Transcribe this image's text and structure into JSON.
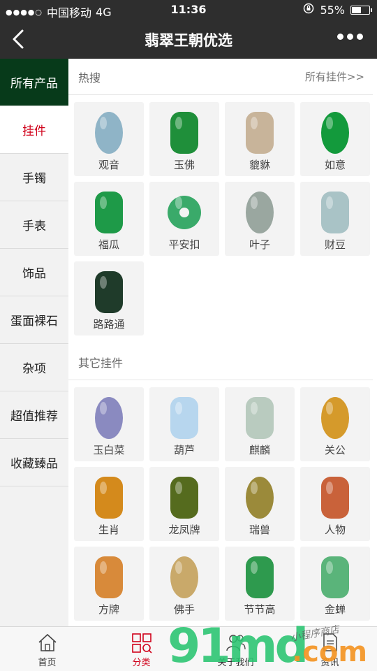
{
  "status": {
    "carrier": "中国移动",
    "network": "4G",
    "time": "11:36",
    "battery": "55%",
    "battery_level": 0.55
  },
  "nav": {
    "title": "翡翠王朝优选"
  },
  "sidebar": {
    "items": [
      {
        "label": "所有产品"
      },
      {
        "label": "挂件"
      },
      {
        "label": "手镯"
      },
      {
        "label": "手表"
      },
      {
        "label": "饰品"
      },
      {
        "label": "蛋面裸石"
      },
      {
        "label": "杂项"
      },
      {
        "label": "超值推荐"
      },
      {
        "label": "收藏臻品"
      }
    ]
  },
  "hot": {
    "title": "热搜",
    "more": "所有挂件>>",
    "items": [
      {
        "label": "观音",
        "color": "#8fb4c7"
      },
      {
        "label": "玉佛",
        "color": "#1f8f3a"
      },
      {
        "label": "貔貅",
        "color": "#c8b49a"
      },
      {
        "label": "如意",
        "color": "#139a3c"
      },
      {
        "label": "福瓜",
        "color": "#1e9a48"
      },
      {
        "label": "平安扣",
        "color": "#3aaa6a"
      },
      {
        "label": "叶子",
        "color": "#9aa7a0"
      },
      {
        "label": "财豆",
        "color": "#a9c3c6"
      },
      {
        "label": "路路通",
        "color": "#1f3b2a"
      }
    ]
  },
  "other": {
    "title": "其它挂件",
    "items": [
      {
        "label": "玉白菜",
        "color": "#8a8ac0"
      },
      {
        "label": "葫芦",
        "color": "#b7d6ee"
      },
      {
        "label": "麒麟",
        "color": "#b9cbbf"
      },
      {
        "label": "关公",
        "color": "#d59a2b"
      },
      {
        "label": "生肖",
        "color": "#d48a1c"
      },
      {
        "label": "龙凤牌",
        "color": "#556b1e"
      },
      {
        "label": "瑞兽",
        "color": "#9b8a3a"
      },
      {
        "label": "人物",
        "color": "#c9623a"
      },
      {
        "label": "方牌",
        "color": "#d88a3a"
      },
      {
        "label": "佛手",
        "color": "#c9a96a"
      },
      {
        "label": "节节高",
        "color": "#2e9a4e"
      },
      {
        "label": "金蝉",
        "color": "#5ab47a"
      }
    ]
  },
  "tabbar": {
    "items": [
      {
        "label": "首页"
      },
      {
        "label": "分类"
      },
      {
        "label": "关于我们"
      },
      {
        "label": "资讯"
      }
    ]
  },
  "watermark": {
    "brand": "91md",
    "domain": ".com",
    "shop": "小程序商店"
  }
}
